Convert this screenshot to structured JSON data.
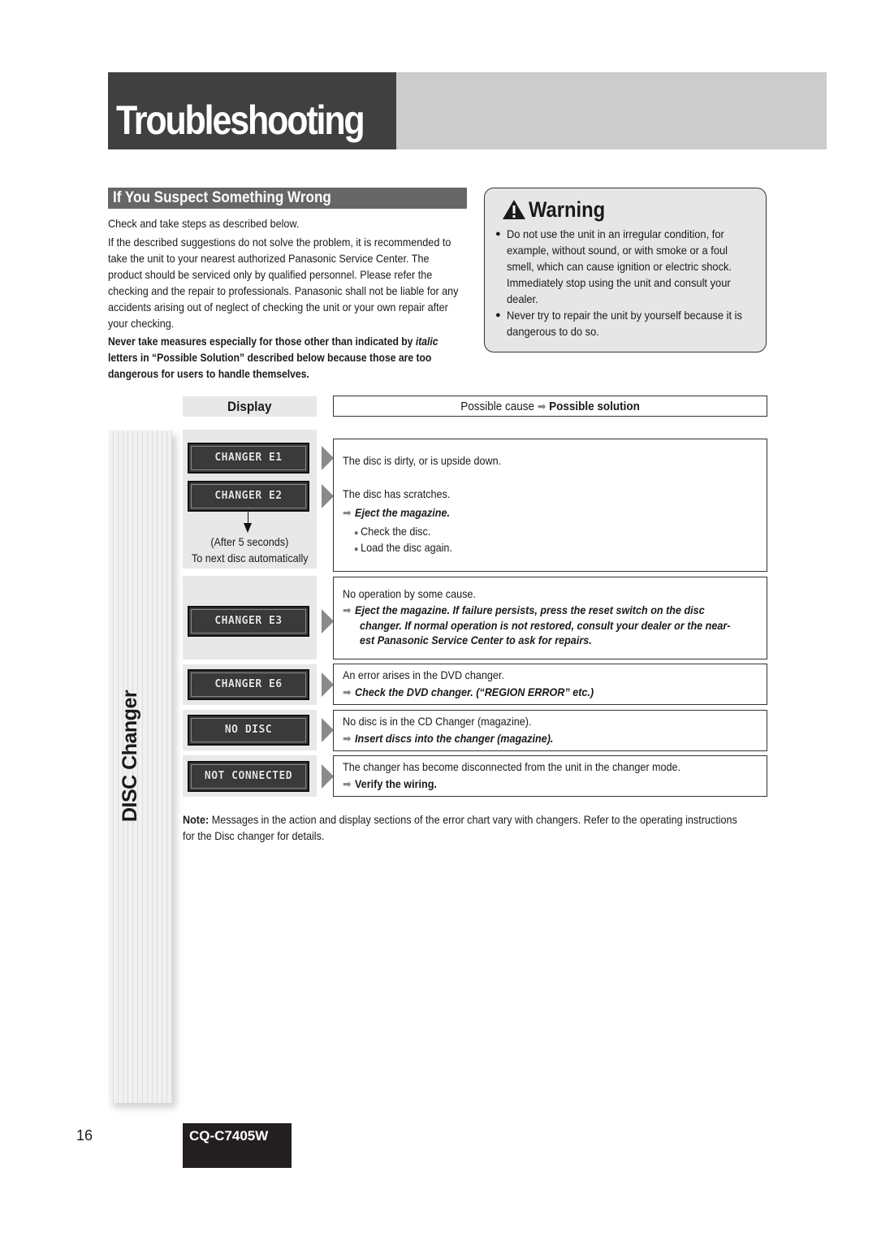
{
  "page_title": "Troubleshooting",
  "section": {
    "title": "If You Suspect Something Wrong",
    "intro_1": "Check and take steps as described below.",
    "intro_2": "If the described suggestions do not solve the problem, it is recommended to take the unit to your nearest authorized Panasonic Service Center. The product should be serviced only by qualified personnel. Please refer the checking and the repair to professionals. Panasonic shall not be liable for any accidents arising out of neglect of checking the unit or your own repair after your checking.",
    "caution_prefix": "Never take measures especially for those other than indicated by ",
    "caution_italic": "italic",
    "caution_suffix": " letters in “Possible Solution” described below because those are too dangerous for users to handle themselves."
  },
  "warning": {
    "title": "Warning",
    "icon": "warning-triangle-icon",
    "items": [
      "Do not use the unit in an irregular condition, for example, without sound, or with smoke or a foul smell, which can cause ignition or electric shock. Immediately stop using the unit and consult your dealer.",
      "Never try to repair the unit by yourself because it is dangerous to do so."
    ]
  },
  "table": {
    "display_header": "Display",
    "cause_header": "Possible cause",
    "solution_header": "Possible solution",
    "side_label": "DISC Changer",
    "rows": [
      {
        "displays": [
          "CHANGER  E1",
          "CHANGER  E2"
        ],
        "caption_1": "(After 5 seconds)",
        "caption_2": "To next disc automatically",
        "cause_1": "The disc is dirty, or is upside down.",
        "cause_2": "The disc has scratches.",
        "solution": "Eject the magazine.",
        "steps": [
          "Check the disc.",
          "Load the disc again."
        ]
      },
      {
        "displays": [
          "CHANGER  E3"
        ],
        "cause": "No operation by some cause.",
        "solution_lines": [
          "Eject the magazine. If failure persists, press the reset switch on the disc",
          "changer. If normal operation is not restored, consult your dealer or the near-",
          "est Panasonic Service Center to ask for repairs."
        ]
      },
      {
        "displays": [
          "CHANGER  E6"
        ],
        "cause": "An error arises in the DVD changer.",
        "solution": "Check the DVD changer. (“REGION ERROR” etc.)"
      },
      {
        "displays": [
          "NO DISC"
        ],
        "cause": "No disc is in the CD Changer (magazine).",
        "solution": "Insert discs into the changer (magazine)."
      },
      {
        "displays": [
          "NOT CONNECTED"
        ],
        "cause": "The changer has become disconnected from the unit in the changer mode.",
        "solution": "Verify the wiring."
      }
    ]
  },
  "note": {
    "label": "Note:",
    "text": " Messages in the action and display sections of the error chart vary with changers. Refer to the operating instructions for the Disc changer for details."
  },
  "footer": {
    "page_number": "16",
    "model": "CQ-C7405W"
  },
  "colors": {
    "title_dark": "#404040",
    "title_light": "#cccccc",
    "section_bar": "#666666",
    "warning_bg": "#e6e6e6",
    "model_badge": "#231f20"
  }
}
